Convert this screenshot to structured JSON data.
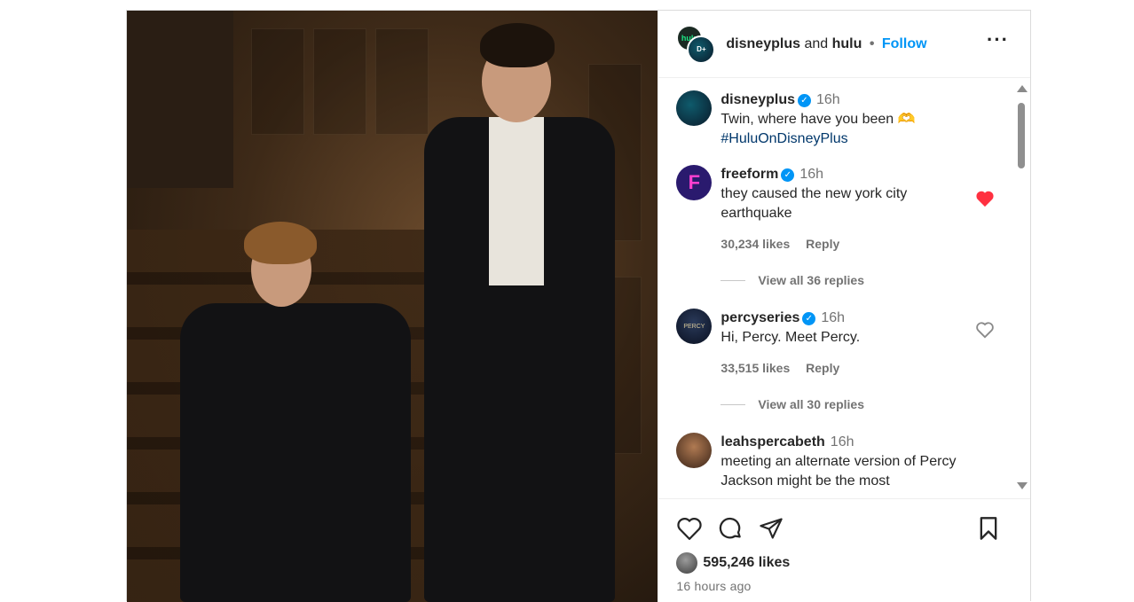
{
  "post": {
    "owner": "disneyplus",
    "and_text": "and",
    "collaborator": "hulu",
    "separator": "•",
    "follow_label": "Follow",
    "more_icon": "more-horizontal-icon",
    "photo_alt": "Two people in suits on a wooden staircase"
  },
  "caption": {
    "user": "disneyplus",
    "time": "16h",
    "text": "Twin, where have you been 🫶",
    "hashtag": "#HuluOnDisneyPlus"
  },
  "comments": [
    {
      "user": "freeform",
      "verified": true,
      "time": "16h",
      "text": "they caused the new york city earthquake",
      "likes": "30,234 likes",
      "reply": "Reply",
      "view_replies": "View all 36 replies",
      "liked": true
    },
    {
      "user": "percyseries",
      "verified": true,
      "time": "16h",
      "text": "Hi, Percy. Meet Percy.",
      "likes": "33,515 likes",
      "reply": "Reply",
      "view_replies": "View all 30 replies",
      "liked": false
    },
    {
      "user": "leahspercabeth",
      "verified": false,
      "time": "16h",
      "text": "meeting an alternate version of Percy Jackson might be the most"
    }
  ],
  "actions": {
    "likes_count": "595,246 likes",
    "time_ago": "16 hours ago"
  },
  "colors": {
    "accent": "#0095f6",
    "liked": "#ff3040",
    "hashtag": "#00376b"
  }
}
